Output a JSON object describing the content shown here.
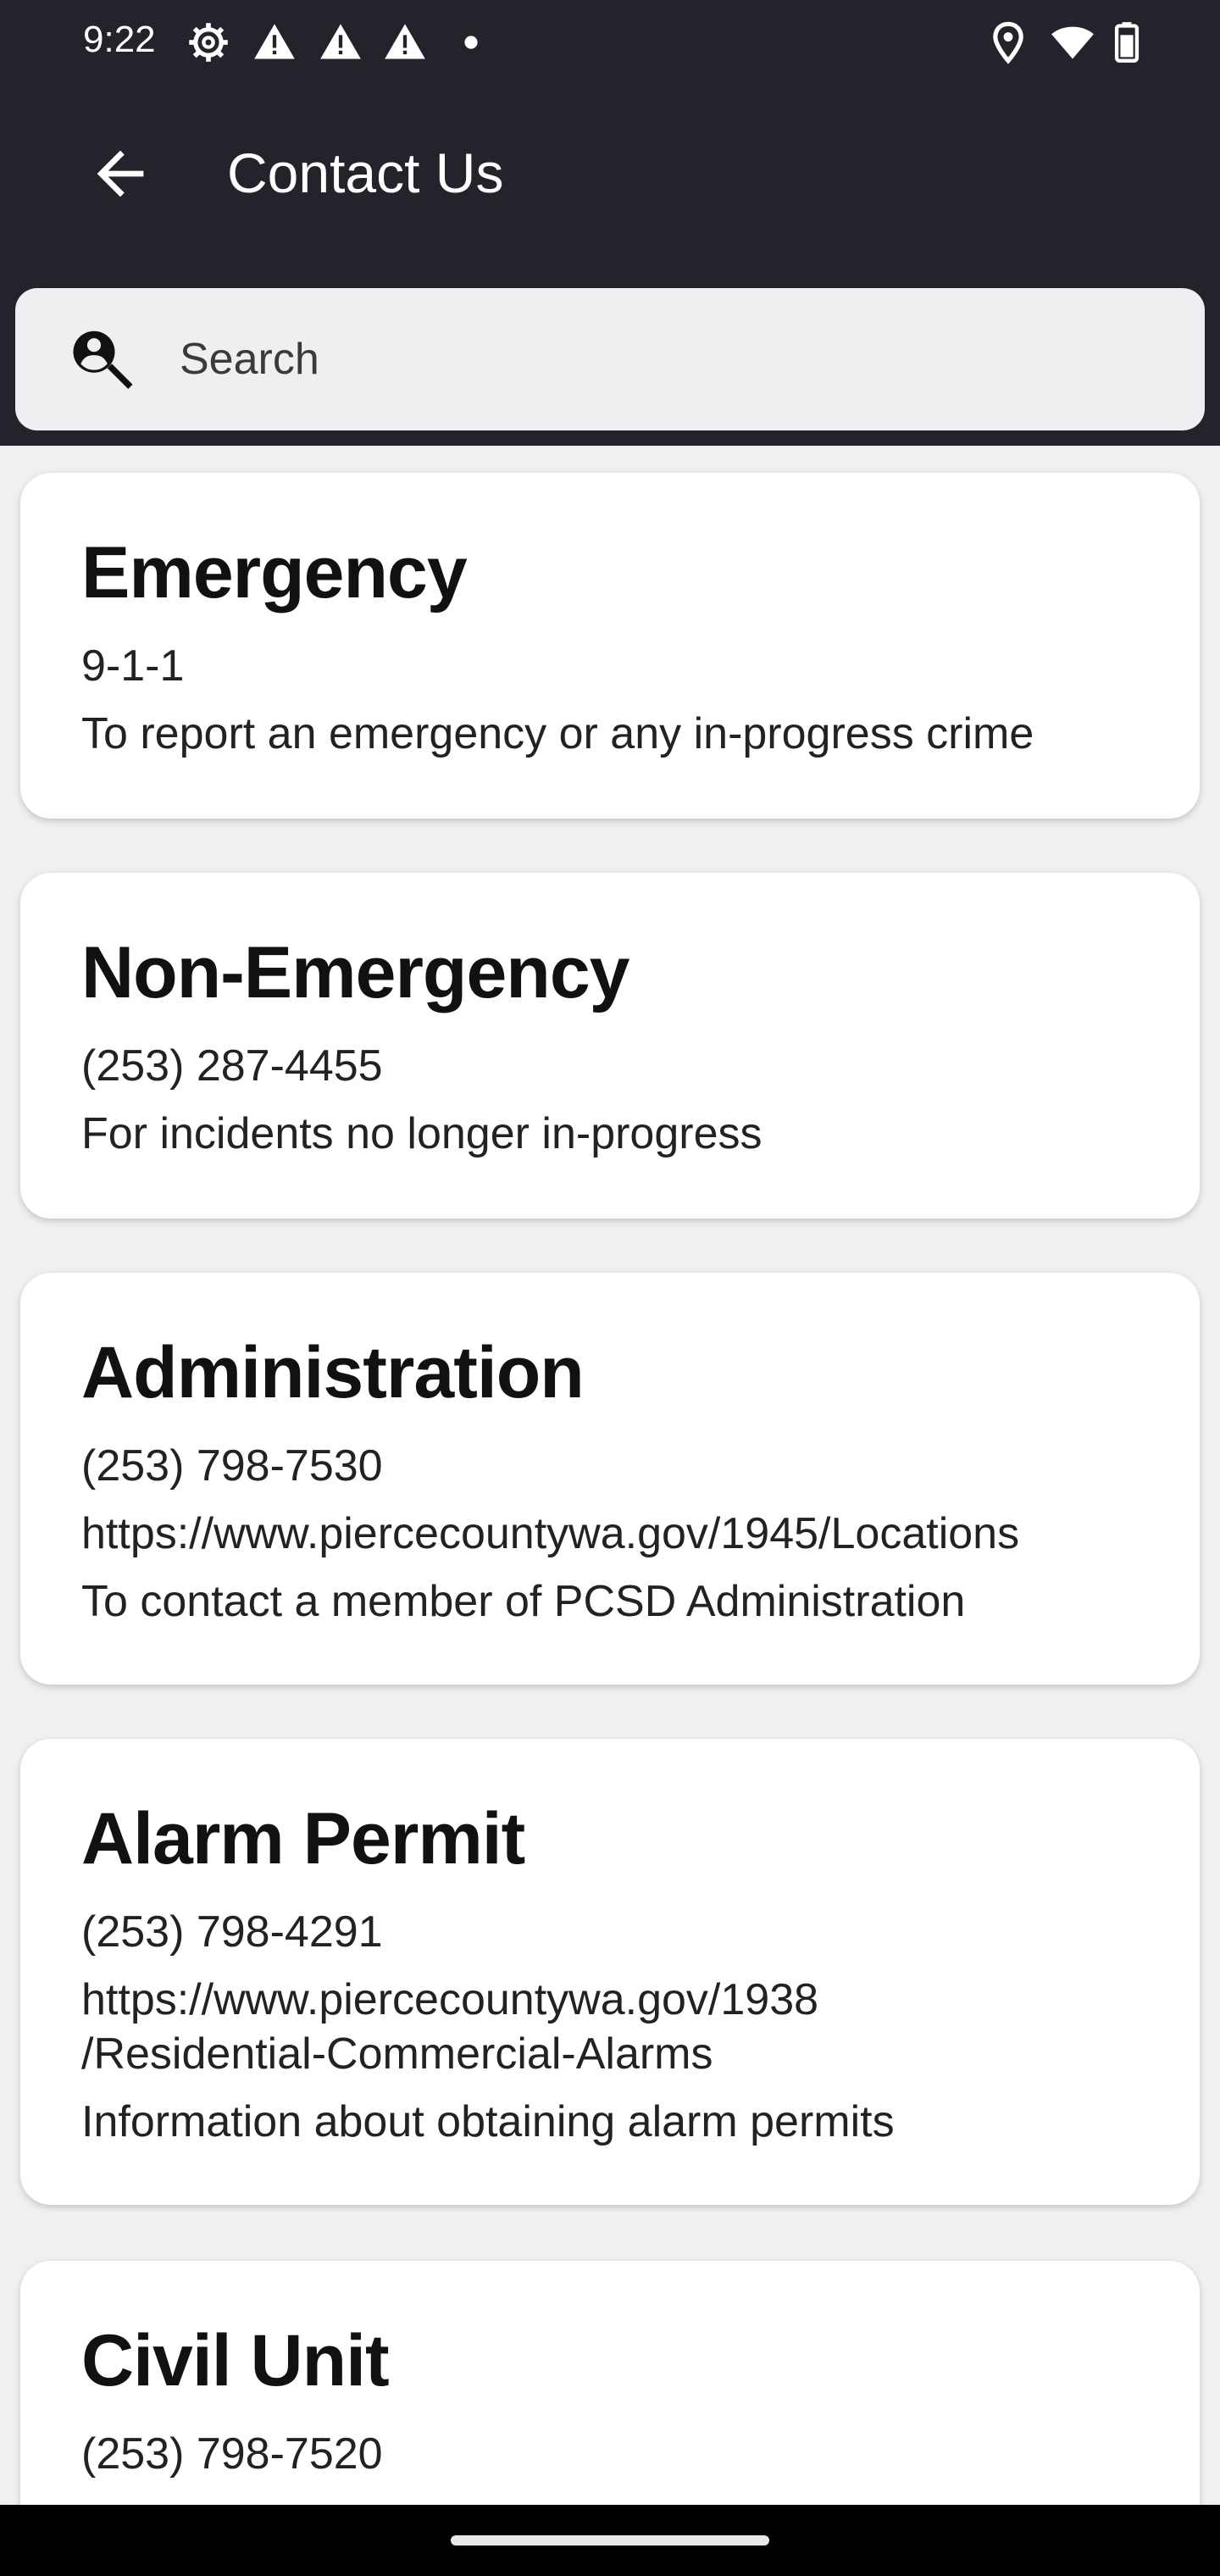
{
  "status_bar": {
    "time": "9:22",
    "icons": [
      "settings-icon",
      "alert-icon",
      "alert-icon",
      "alert-icon",
      "dot-icon",
      "location-icon",
      "wifi-icon",
      "battery-icon"
    ]
  },
  "app_bar": {
    "title": "Contact Us",
    "back_icon": "arrow-left-icon"
  },
  "search": {
    "placeholder": "Search",
    "value": "",
    "icon": "person-search-icon"
  },
  "contacts": [
    {
      "title": "Emergency",
      "phone": "9-1-1",
      "description": "To report an emergency or any in-progress crime"
    },
    {
      "title": "Non-Emergency",
      "phone": "(253) 287-4455",
      "description": "For incidents no longer in-progress"
    },
    {
      "title": "Administration",
      "phone": "(253) 798-7530",
      "url": "https://www.piercecountywa.gov/1945/Locations",
      "description": "To contact a member of PCSD Administration"
    },
    {
      "title": "Alarm Permit",
      "phone": "(253) 798-4291",
      "url_line1": "https://www.piercecountywa.gov/1938",
      "url_line2": "/Residential-Commercial-Alarms",
      "description": "Information about obtaining alarm permits"
    },
    {
      "title": "Civil Unit",
      "phone": "(253) 798-7520"
    }
  ],
  "colors": {
    "header_bg": "#23232b",
    "page_bg": "#f0f0f2",
    "card_bg": "#ffffff"
  }
}
